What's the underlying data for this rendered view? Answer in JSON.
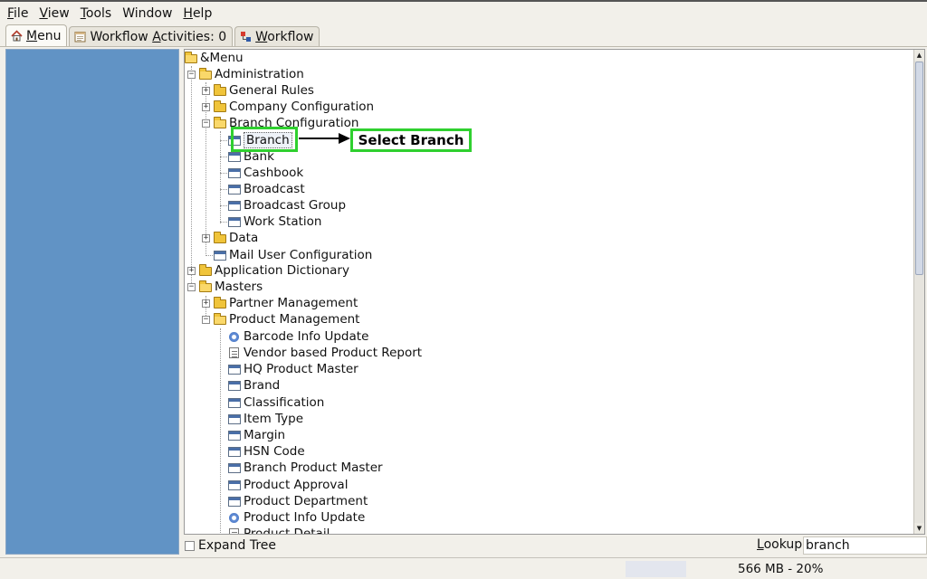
{
  "menubar": {
    "items": [
      {
        "u": "F",
        "rest": "ile"
      },
      {
        "u": "V",
        "rest": "iew"
      },
      {
        "u": "T",
        "rest": "ools"
      },
      {
        "u": "",
        "rest": "Window"
      },
      {
        "u": "H",
        "rest": "elp"
      }
    ]
  },
  "tabs": {
    "menu": {
      "u": "M",
      "rest": "enu"
    },
    "activities": {
      "pre": "Workflow ",
      "u": "A",
      "rest": "ctivities: 0"
    },
    "workflow": {
      "u": "W",
      "rest": "orkflow"
    }
  },
  "tree": {
    "root": "&Menu",
    "administration": "Administration",
    "general_rules": "General Rules",
    "company_configuration": "Company Configuration",
    "branch_configuration": "Branch Configuration",
    "branch": "Branch",
    "bank": "Bank",
    "cashbook": "Cashbook",
    "broadcast": "Broadcast",
    "broadcast_group": "Broadcast Group",
    "work_station": "Work Station",
    "data": "Data",
    "mail_user_configuration": "Mail User Configuration",
    "application_dictionary": "Application Dictionary",
    "masters": "Masters",
    "partner_management": "Partner Management",
    "product_management": "Product Management",
    "barcode_info_update": "Barcode Info Update",
    "vendor_based_product_report": "Vendor based Product Report",
    "hq_product_master": "HQ Product Master",
    "brand": "Brand",
    "classification": "Classification",
    "item_type": "Item Type",
    "margin": "Margin",
    "hsn_code": "HSN Code",
    "branch_product_master": "Branch Product Master",
    "product_approval": "Product Approval",
    "product_department": "Product Department",
    "product_info_update": "Product Info Update",
    "product_detail": "Product Detail"
  },
  "annotation": {
    "callout": "Select Branch",
    "highlight_color": "#2fd02f"
  },
  "bottom": {
    "expand_tree": {
      "u": "E",
      "rest": "xpand Tree"
    },
    "lookup": {
      "u": "L",
      "rest": "ookup"
    },
    "lookup_value": "branch"
  },
  "status": {
    "memory": "566 MB - 20%"
  },
  "colors": {
    "left_panel": "#6193c5",
    "background": "#f2f0ea"
  }
}
